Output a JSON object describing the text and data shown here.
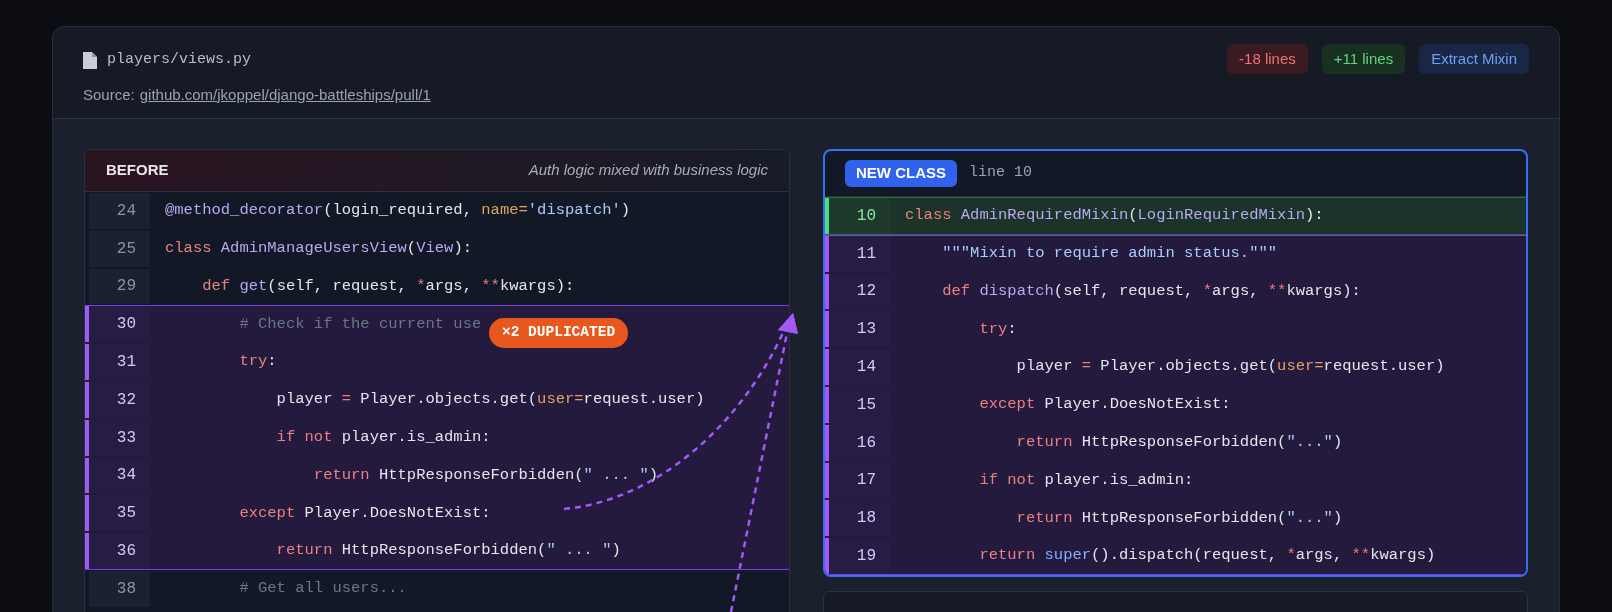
{
  "file": {
    "path": "players/views.py",
    "source_label": "Source:",
    "source_link": "github.com/jkoppel/django-battleships/pull/1"
  },
  "badges": [
    {
      "text": "-18 lines",
      "kind": "removed"
    },
    {
      "text": "+11 lines",
      "kind": "added"
    },
    {
      "text": "Extract Mixin",
      "kind": "refactor"
    }
  ],
  "before_panel": {
    "title": "BEFORE",
    "note": "Auth logic mixed with business logic",
    "callout": "×2 DUPLICATED",
    "lines": [
      {
        "number": "24",
        "kind": "plain",
        "tokens": [
          {
            "kind": "fn",
            "text": "@method_decorator"
          },
          {
            "kind": "tx",
            "text": "(login_required, "
          },
          {
            "kind": "arg",
            "text": "name="
          },
          {
            "kind": "str",
            "text": "'dispatch'"
          },
          {
            "kind": "tx",
            "text": ")"
          }
        ]
      },
      {
        "number": "25",
        "kind": "plain",
        "tokens": [
          {
            "kind": "kw",
            "text": "class "
          },
          {
            "kind": "fn",
            "text": "AdminManageUsersView"
          },
          {
            "kind": "tx",
            "text": "("
          },
          {
            "kind": "fn",
            "text": "View"
          },
          {
            "kind": "tx",
            "text": "):"
          }
        ]
      },
      {
        "number": "29",
        "kind": "plain",
        "tokens": [
          {
            "kind": "kw",
            "text": "    def "
          },
          {
            "kind": "fn",
            "text": "get"
          },
          {
            "kind": "tx",
            "text": "(self, request, "
          },
          {
            "kind": "op",
            "text": "*"
          },
          {
            "kind": "tx",
            "text": "args, "
          },
          {
            "kind": "op",
            "text": "**"
          },
          {
            "kind": "tx",
            "text": "kwargs):"
          }
        ]
      },
      {
        "number": "30",
        "kind": "duplicated",
        "tokens": [
          {
            "kind": "cm",
            "text": "        # Check if the current use"
          }
        ]
      },
      {
        "number": "31",
        "kind": "duplicated",
        "tokens": [
          {
            "kind": "kw",
            "text": "        try"
          },
          {
            "kind": "tx",
            "text": ":"
          }
        ]
      },
      {
        "number": "32",
        "kind": "duplicated",
        "tokens": [
          {
            "kind": "tx",
            "text": "            player "
          },
          {
            "kind": "op",
            "text": "="
          },
          {
            "kind": "tx",
            "text": " Player.objects.get("
          },
          {
            "kind": "arg",
            "text": "user="
          },
          {
            "kind": "tx",
            "text": "request.user)"
          }
        ]
      },
      {
        "number": "33",
        "kind": "duplicated",
        "tokens": [
          {
            "kind": "kw",
            "text": "            if not "
          },
          {
            "kind": "tx",
            "text": "player.is_admin:"
          }
        ]
      },
      {
        "number": "34",
        "kind": "duplicated",
        "tokens": [
          {
            "kind": "kw",
            "text": "                return "
          },
          {
            "kind": "tx",
            "text": "HttpResponseForbidden("
          },
          {
            "kind": "str",
            "text": "\" ... \""
          },
          {
            "kind": "tx",
            "text": ")"
          }
        ]
      },
      {
        "number": "35",
        "kind": "duplicated",
        "tokens": [
          {
            "kind": "kw",
            "text": "        except "
          },
          {
            "kind": "tx",
            "text": "Player.DoesNotExist:"
          }
        ]
      },
      {
        "number": "36",
        "kind": "duplicated",
        "tokens": [
          {
            "kind": "kw",
            "text": "            return "
          },
          {
            "kind": "tx",
            "text": "HttpResponseForbidden("
          },
          {
            "kind": "str",
            "text": "\" ... \""
          },
          {
            "kind": "tx",
            "text": ")"
          }
        ]
      },
      {
        "number": "38",
        "kind": "plain",
        "tokens": [
          {
            "kind": "cm",
            "text": "        # Get all users..."
          }
        ]
      }
    ]
  },
  "new_class_panel": {
    "badge": "NEW CLASS",
    "location": "line 10",
    "lines": [
      {
        "number": "10",
        "kind": "added",
        "tokens": [
          {
            "kind": "kw",
            "text": "class "
          },
          {
            "kind": "fn",
            "text": "AdminRequiredMixin"
          },
          {
            "kind": "tx",
            "text": "("
          },
          {
            "kind": "fn",
            "text": "LoginRequiredMixin"
          },
          {
            "kind": "tx",
            "text": "):"
          }
        ]
      },
      {
        "number": "11",
        "kind": "duplicated",
        "tokens": [
          {
            "kind": "str",
            "text": "    \"\"\"Mixin to require admin status.\"\"\""
          }
        ]
      },
      {
        "number": "12",
        "kind": "duplicated",
        "tokens": [
          {
            "kind": "kw",
            "text": "    def "
          },
          {
            "kind": "fn",
            "text": "dispatch"
          },
          {
            "kind": "tx",
            "text": "(self, request, "
          },
          {
            "kind": "op",
            "text": "*"
          },
          {
            "kind": "tx",
            "text": "args, "
          },
          {
            "kind": "op",
            "text": "**"
          },
          {
            "kind": "tx",
            "text": "kwargs):"
          }
        ]
      },
      {
        "number": "13",
        "kind": "duplicated",
        "tokens": [
          {
            "kind": "kw",
            "text": "        try"
          },
          {
            "kind": "tx",
            "text": ":"
          }
        ]
      },
      {
        "number": "14",
        "kind": "duplicated",
        "tokens": [
          {
            "kind": "tx",
            "text": "            player "
          },
          {
            "kind": "op",
            "text": "="
          },
          {
            "kind": "tx",
            "text": " Player.objects.get("
          },
          {
            "kind": "arg",
            "text": "user="
          },
          {
            "kind": "tx",
            "text": "request.user)"
          }
        ]
      },
      {
        "number": "15",
        "kind": "duplicated",
        "tokens": [
          {
            "kind": "kw",
            "text": "        except "
          },
          {
            "kind": "tx",
            "text": "Player.DoesNotExist:"
          }
        ]
      },
      {
        "number": "16",
        "kind": "duplicated",
        "tokens": [
          {
            "kind": "kw",
            "text": "            return "
          },
          {
            "kind": "tx",
            "text": "HttpResponseForbidden("
          },
          {
            "kind": "str",
            "text": "\"...\""
          },
          {
            "kind": "tx",
            "text": ")"
          }
        ]
      },
      {
        "number": "17",
        "kind": "duplicated",
        "tokens": [
          {
            "kind": "kw",
            "text": "        if not "
          },
          {
            "kind": "tx",
            "text": "player.is_admin:"
          }
        ]
      },
      {
        "number": "18",
        "kind": "duplicated",
        "tokens": [
          {
            "kind": "kw",
            "text": "            return "
          },
          {
            "kind": "tx",
            "text": "HttpResponseForbidden("
          },
          {
            "kind": "str",
            "text": "\"...\""
          },
          {
            "kind": "tx",
            "text": ")"
          }
        ]
      },
      {
        "number": "19",
        "kind": "duplicated",
        "tokens": [
          {
            "kind": "kw",
            "text": "        return "
          },
          {
            "kind": "bi",
            "text": "super"
          },
          {
            "kind": "tx",
            "text": "().dispatch(request, "
          },
          {
            "kind": "op",
            "text": "*"
          },
          {
            "kind": "tx",
            "text": "args, "
          },
          {
            "kind": "op",
            "text": "**"
          },
          {
            "kind": "tx",
            "text": "kwargs)"
          }
        ]
      }
    ]
  }
}
